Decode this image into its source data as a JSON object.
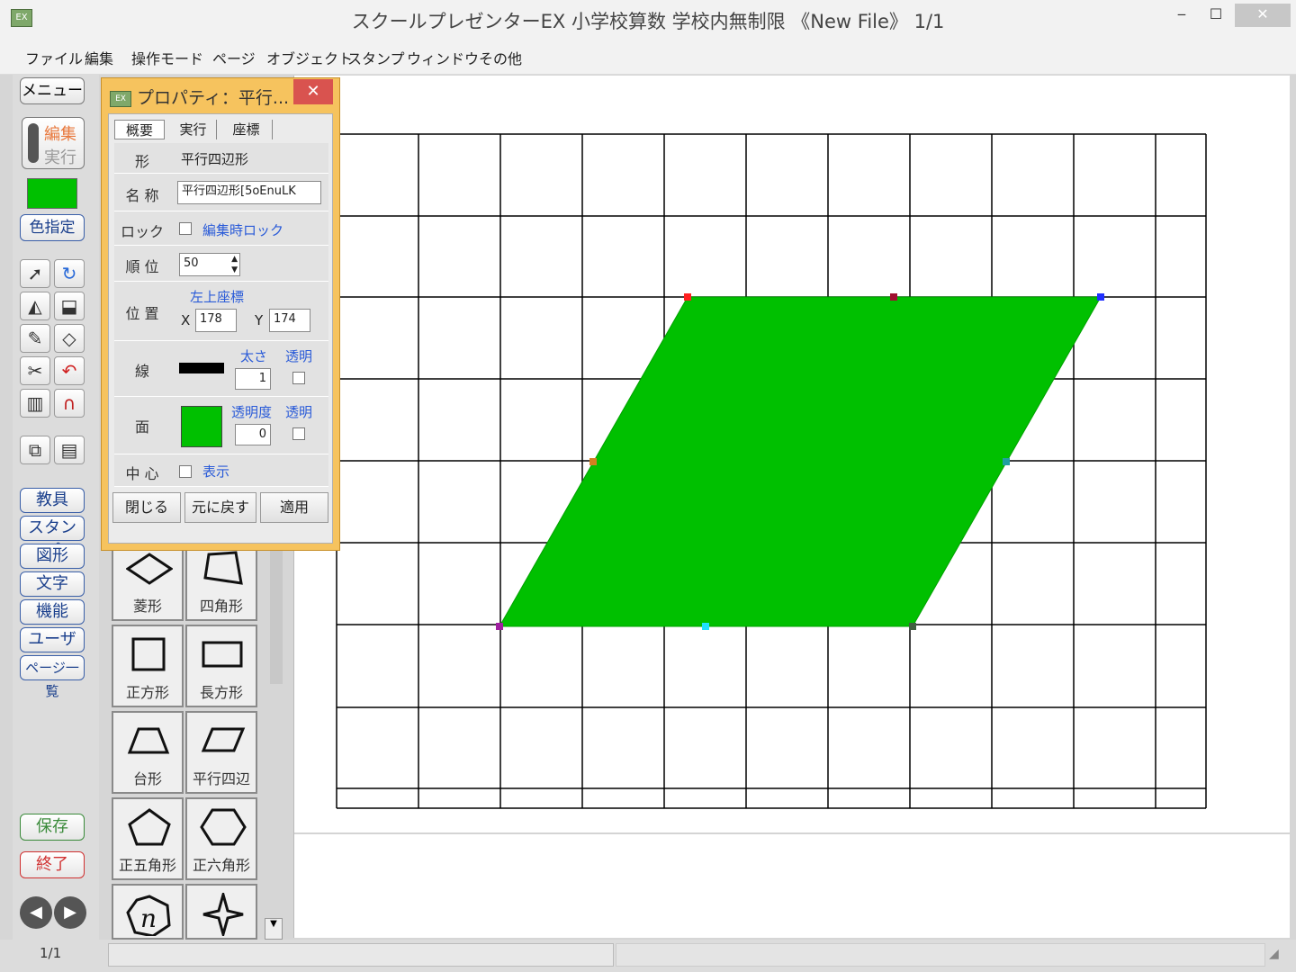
{
  "window": {
    "title": "スクールプレゼンターEX 小学校算数 学校内無制限 《New File》 1/1",
    "icon_label": "EX",
    "minimize": "‒",
    "maximize": "☐",
    "close": "✕"
  },
  "menu": [
    "ファイル",
    "編集",
    "操作モード",
    "ページ",
    "オブジェクト",
    "スタンプ",
    "ウィンドウ",
    "その他"
  ],
  "left_toolbar": {
    "menu_button": "メニュー",
    "mode_edit": "編集",
    "mode_run": "実行",
    "current_color": "#00c000",
    "color_button": "色指定",
    "categories": [
      "教具",
      "スタンプ",
      "図形",
      "文字",
      "機能",
      "ユーザー",
      "ページ一覧"
    ],
    "save": "保存",
    "quit": "終了",
    "page_counter": "1/1"
  },
  "shape_palette": [
    "菱形",
    "四角形",
    "正方形",
    "長方形",
    "台形",
    "平行四辺",
    "正五角形",
    "正六角形"
  ],
  "property_dialog": {
    "title": "プロパティ：平行...",
    "close": "✕",
    "tabs": [
      "概要",
      "実行",
      "座標"
    ],
    "rows": {
      "shape_label": "形",
      "shape_value": "平行四辺形",
      "name_label": "名 称",
      "name_value": "平行四辺形[5oEnuLK",
      "lock_label": "ロック",
      "lock_option": "編集時ロック",
      "order_label": "順 位",
      "order_value": "50",
      "position_label": "位 置",
      "position_caption": "左上座標",
      "x_label": "X",
      "x_value": "178",
      "y_label": "Y",
      "y_value": "174",
      "line_label": "線",
      "line_width_label": "太さ",
      "line_width_value": "1",
      "line_transparent_label": "透明",
      "fill_label": "面",
      "fill_opacity_label": "透明度",
      "fill_opacity_value": "0",
      "fill_transparent_label": "透明",
      "fill_color": "#00c000",
      "center_label": "中 心",
      "center_option": "表示"
    },
    "buttons": [
      "閉じる",
      "元に戻す",
      "適用"
    ]
  },
  "canvas": {
    "shape_fill": "#00c000",
    "grid_color": "#000000"
  }
}
